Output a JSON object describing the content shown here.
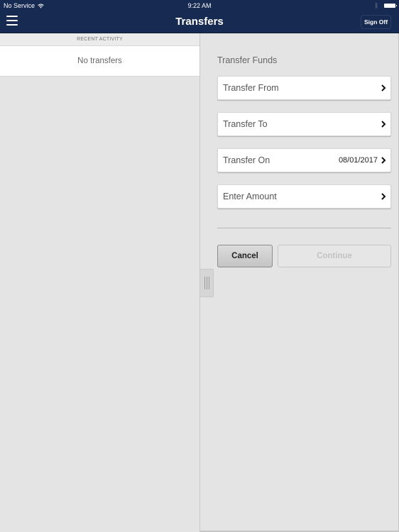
{
  "status_bar": {
    "carrier": "No Service",
    "wifi_icon": "wifi-icon",
    "time": "9:22 AM",
    "bluetooth_icon": "bluetooth-icon",
    "battery_icon": "battery-icon"
  },
  "header": {
    "menu_icon": "hamburger-menu-icon",
    "title": "Transfers",
    "sign_off_label": "Sign Off",
    "background_color": "#172a52"
  },
  "recent_activity": {
    "section_label": "RECENT ACTIVITY",
    "empty_message": "No transfers"
  },
  "transfer_form": {
    "section_title": "Transfer Funds",
    "fields": [
      {
        "label": "Transfer From",
        "value": ""
      },
      {
        "label": "Transfer To",
        "value": ""
      },
      {
        "label": "Transfer On",
        "value": "08/01/2017"
      },
      {
        "label": "Enter Amount",
        "value": ""
      }
    ],
    "cancel_label": "Cancel",
    "continue_label": "Continue",
    "continue_enabled": false
  },
  "split_handle_icon": "drag-handle-icon"
}
